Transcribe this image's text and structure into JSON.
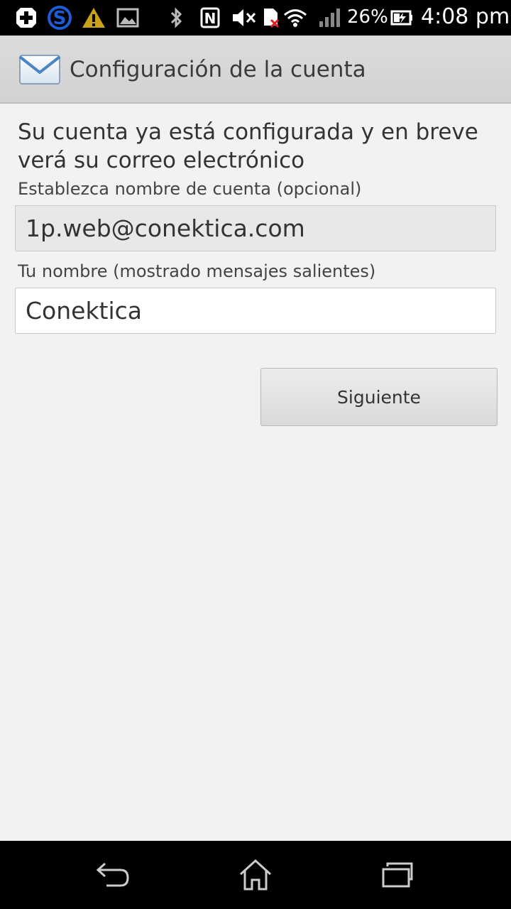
{
  "status_bar": {
    "battery_percent": "26%",
    "time": "4:08 pm",
    "icons": [
      "plus-notification-icon",
      "skype-icon",
      "warning-icon",
      "image-icon",
      "bluetooth-icon",
      "nfc-icon",
      "mute-icon",
      "sim-error-icon",
      "wifi-icon",
      "signal-icon",
      "battery-icon"
    ]
  },
  "action_bar": {
    "title": "Configuración de la cuenta",
    "icon": "mail-icon"
  },
  "main": {
    "intro": "Su cuenta ya está configurada y en breve verá su correo electrónico",
    "account_label": "Establezca nombre de cuenta (opcional)",
    "account_value": "1p.web@conektica.com",
    "name_label": "Tu nombre (mostrado mensajes salientes)",
    "name_value": "Conektica",
    "next_label": "Siguiente"
  },
  "nav_bar": {
    "icons": [
      "back-icon",
      "home-icon",
      "recent-apps-icon"
    ]
  },
  "colors": {
    "background": "#f2f2f1",
    "action_bar": "#d6d6d6",
    "status_bar": "#000000"
  }
}
